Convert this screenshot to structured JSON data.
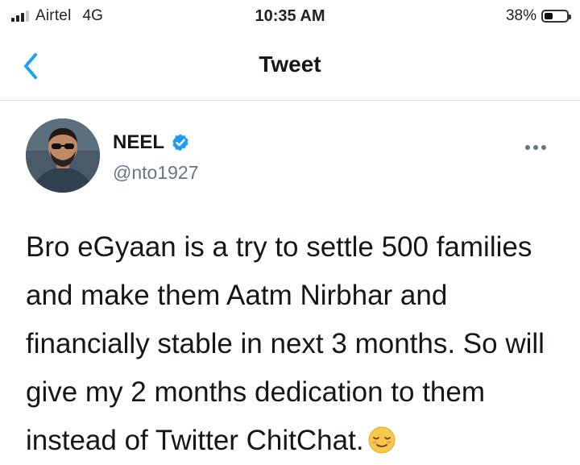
{
  "status_bar": {
    "carrier": "Airtel",
    "network": "4G",
    "time": "10:35 AM",
    "battery": "38%",
    "battery_level": 0.38,
    "signal_icon": "signal-bars-icon",
    "battery_icon": "battery-icon"
  },
  "nav": {
    "title": "Tweet",
    "back_icon": "chevron-left-icon"
  },
  "tweet": {
    "author_name": "NEEL",
    "handle": "@nto1927",
    "verified_icon": "verified-badge-icon",
    "more_icon": "more-dots-icon",
    "text": "Bro eGyaan is a try to settle 500 families and make them Aatm Nirbhar and financially stable in next 3 months. So will give my 2 months dedication to them instead of Twitter ChitChat.",
    "emoji": "relieved-face-emoji"
  },
  "colors": {
    "accent": "#1da1f2",
    "verified": "#1d9bf0",
    "text_primary": "#14171a",
    "text_secondary": "#657786",
    "divider": "#d9dde0"
  }
}
